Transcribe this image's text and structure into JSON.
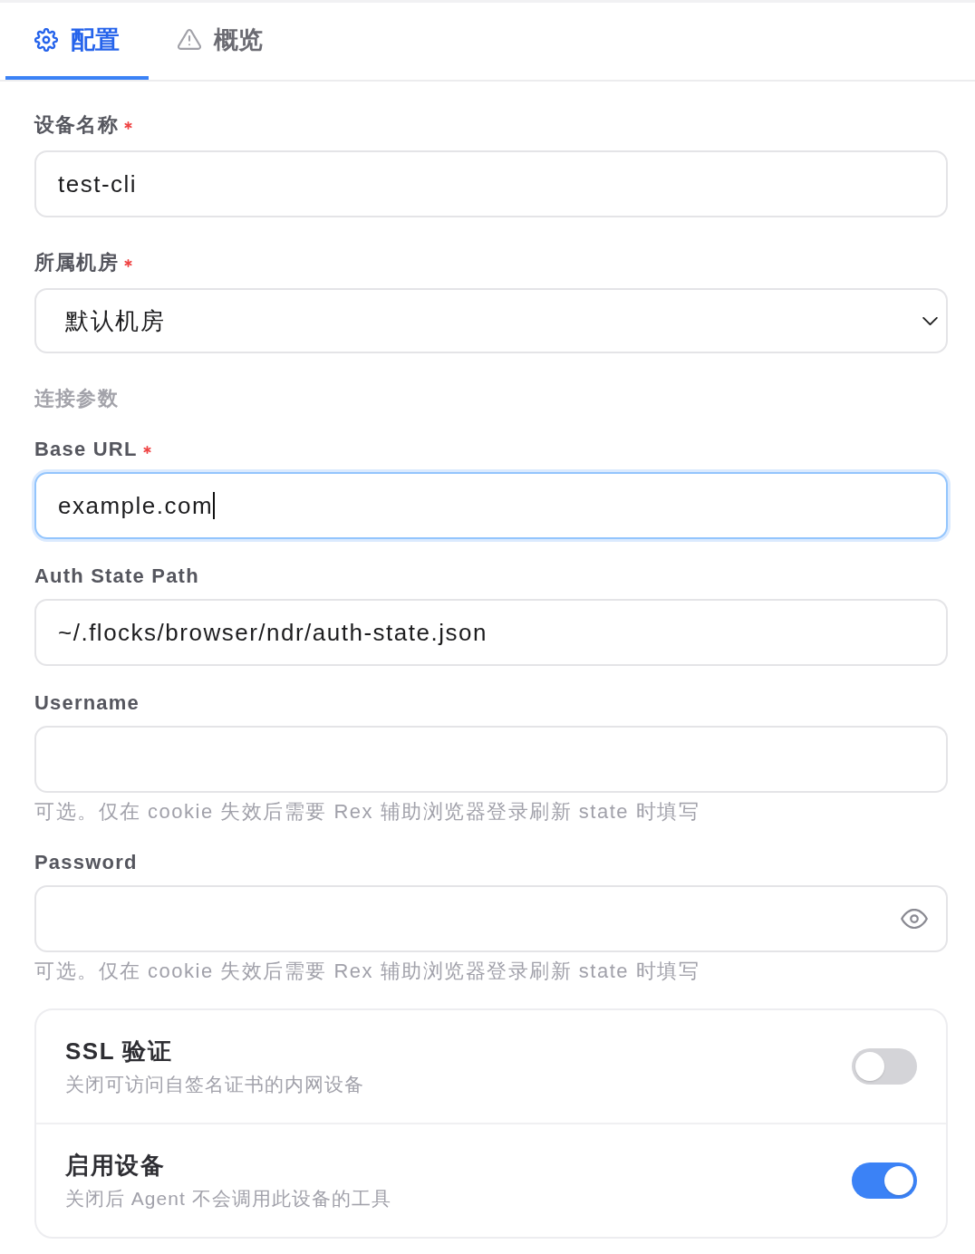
{
  "tabs": [
    {
      "kind": "settings",
      "label": "配置",
      "selected": true
    },
    {
      "kind": "overview",
      "label": "概览",
      "selected": false
    }
  ],
  "basic_fields": [
    {
      "kind": "input",
      "label": "设备名称",
      "required": true,
      "value": "test-cli",
      "focused": false
    },
    {
      "kind": "select",
      "label": "所属机房",
      "required": true,
      "value": "默认机房"
    }
  ],
  "connection": {
    "heading": "连接参数",
    "fields": [
      {
        "kind": "input",
        "label": "Base URL",
        "required": true,
        "value": "example.com",
        "focused": true
      },
      {
        "kind": "input",
        "label": "Auth State Path",
        "required": false,
        "value": "~/.flocks/browser/ndr/auth-state.json",
        "focused": false
      },
      {
        "kind": "input",
        "label": "Username",
        "required": false,
        "focused": false,
        "hint": "可选。仅在 cookie 失效后需要 Rex 辅助浏览器登录刷新 state 时填写"
      },
      {
        "kind": "password",
        "label": "Password",
        "required": false,
        "focused": false,
        "hint": "可选。仅在 cookie 失效后需要 Rex 辅助浏览器登录刷新 state 时填写"
      }
    ]
  },
  "switches": [
    {
      "title": "SSL 验证",
      "description": "关闭可访问自签名证书的内网设备",
      "on": false
    },
    {
      "title": "启用设备",
      "description": "关闭后 Agent 不会调用此设备的工具",
      "on": true
    }
  ]
}
